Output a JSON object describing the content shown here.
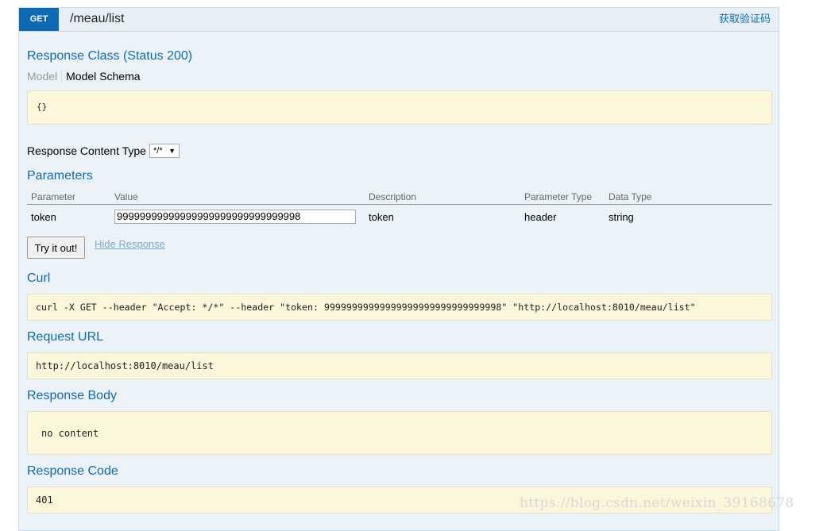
{
  "operation": {
    "method": "GET",
    "path": "/meau/list",
    "summary": "获取验证码"
  },
  "response_class": {
    "heading": "Response Class (Status 200)",
    "tab_model": "Model",
    "tab_schema": "Model Schema",
    "schema": "{}"
  },
  "content_type": {
    "label": "Response Content Type",
    "selected": "*/*"
  },
  "parameters": {
    "heading": "Parameters",
    "columns": [
      "Parameter",
      "Value",
      "Description",
      "Parameter Type",
      "Data Type"
    ],
    "rows": [
      {
        "name": "token",
        "value": "99999999999999999999999999999998",
        "description": "token",
        "param_type": "header",
        "data_type": "string"
      }
    ]
  },
  "actions": {
    "try_label": "Try it out!",
    "hide_label": "Hide Response"
  },
  "curl": {
    "heading": "Curl",
    "command": "curl -X GET --header \"Accept: */*\" --header \"token: 99999999999999999999999999999998\" \"http://localhost:8010/meau/list\""
  },
  "request_url": {
    "heading": "Request URL",
    "value": "http://localhost:8010/meau/list"
  },
  "response_body": {
    "heading": "Response Body",
    "value": "no content"
  },
  "response_code": {
    "heading": "Response Code",
    "value": "401"
  },
  "watermark": "https://blog.csdn.net/weixin_39168678",
  "colors": {
    "method_bg": "#0f6ab4",
    "heading_blue": "#0f6ab4",
    "panel_bg": "#ebf3f9",
    "code_bg": "#fcf6db"
  }
}
